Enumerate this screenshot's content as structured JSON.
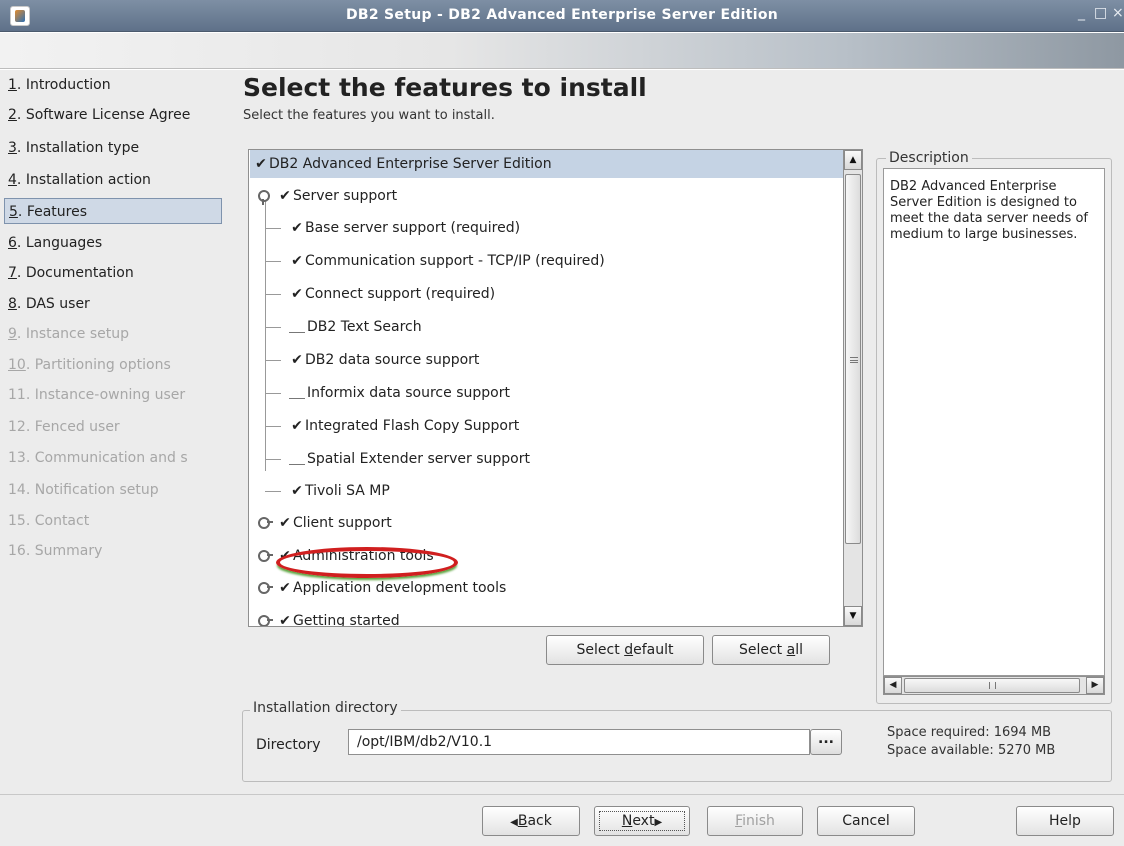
{
  "window": {
    "title": "DB2 Setup - DB2 Advanced Enterprise Server Edition",
    "minimize_glyph": "_",
    "maximize_glyph": "□",
    "close_glyph": "×"
  },
  "steps": [
    {
      "num": "1",
      "label": ". Introduction"
    },
    {
      "num": "2",
      "label": ". Software License Agree"
    },
    {
      "num": "3",
      "label": ". Installation type"
    },
    {
      "num": "4",
      "label": ". Installation action"
    },
    {
      "num": "5",
      "label": ". Features"
    },
    {
      "num": "6",
      "label": ". Languages"
    },
    {
      "num": "7",
      "label": ". Documentation"
    },
    {
      "num": "8",
      "label": ". DAS user"
    },
    {
      "num": "9",
      "label": ". Instance setup"
    },
    {
      "num": "10",
      "label": ". Partitioning options"
    },
    {
      "num": "11",
      "label": ". Instance-owning user"
    },
    {
      "num": "12",
      "label": ". Fenced user"
    },
    {
      "num": "13",
      "label": ". Communication and s"
    },
    {
      "num": "14",
      "label": ". Notification setup"
    },
    {
      "num": "15",
      "label": ". Contact"
    },
    {
      "num": "16",
      "label": ". Summary"
    }
  ],
  "page": {
    "heading": "Select the features to install",
    "subheading": "Select the features you want to install."
  },
  "tree": {
    "root": "DB2 Advanced Enterprise Server Edition",
    "server_support": "Server support",
    "children": [
      "Base server support (required)",
      "Communication support - TCP/IP (required)",
      "Connect support (required)",
      "DB2 Text Search",
      "DB2 data source support",
      "Informix data source support",
      "Integrated Flash Copy Support",
      "Spatial Extender server support",
      "Tivoli SA MP"
    ],
    "client_support": "Client support",
    "admin_tools": "Administration tools",
    "app_dev_tools": "Application development tools",
    "getting_started": "Getting started",
    "check_glyph": "✔",
    "scroll_up_glyph": "▲",
    "scroll_down_glyph": "▼"
  },
  "buttons": {
    "select_default_pre": "Select ",
    "select_default_mn": "d",
    "select_default_post": "efault",
    "select_all_pre": "Select ",
    "select_all_mn": "a",
    "select_all_post": "ll",
    "back_mn": "B",
    "back_post": "ack",
    "next_mn": "N",
    "next_post": "ext",
    "finish_mn": "F",
    "finish_post": "inish",
    "cancel": "Cancel",
    "help": "Help",
    "back_arrow": "◀",
    "next_arrow": "▶"
  },
  "description": {
    "legend": "Description",
    "text": "DB2 Advanced Enterprise Server Edition is designed to meet the data server needs of medium to large businesses.",
    "scroll_left_glyph": "◀",
    "scroll_right_glyph": "▶"
  },
  "installation": {
    "legend": "Installation directory",
    "dir_label": "Directory",
    "dir_value": "/opt/IBM/db2/V10.1",
    "browse_label": "...",
    "space_required": "Space required: 1694 MB",
    "space_available": "Space available: 5270 MB"
  }
}
